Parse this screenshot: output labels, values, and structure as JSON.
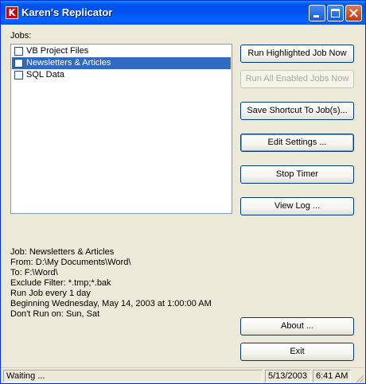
{
  "window": {
    "title": "Karen's Replicator",
    "icon_letter": "K"
  },
  "jobs": {
    "label": "Jobs:",
    "items": [
      {
        "label": "VB Project Files",
        "checked": false,
        "selected": false
      },
      {
        "label": "Newsletters & Articles",
        "checked": false,
        "selected": true
      },
      {
        "label": "SQL Data",
        "checked": false,
        "selected": false
      }
    ]
  },
  "buttons": {
    "run_highlighted": "Run Highlighted Job Now",
    "run_all_enabled": "Run All Enabled Jobs Now",
    "save_shortcut": "Save Shortcut To Job(s)...",
    "edit_settings": "Edit Settings ...",
    "stop_timer": "Stop Timer",
    "view_log": "View Log ...",
    "about": "About ...",
    "exit": "Exit"
  },
  "job_info": {
    "job": "Job: Newsletters & Articles",
    "from": "From: D:\\My Documents\\Word\\",
    "to": "To: F:\\Word\\",
    "exclude": "Exclude Filter: *.tmp;*.bak",
    "run": "Run Job every 1 day",
    "beginning": "Beginning Wednesday, May 14, 2003 at 1:00:00 AM",
    "dont_run": "Don't Run on: Sun, Sat"
  },
  "status": {
    "text": "Waiting ...",
    "date": "5/13/2003",
    "time": "6:41 AM"
  },
  "icons": [
    "minimize-icon",
    "maximize-icon",
    "close-icon",
    "size-grip-icon"
  ]
}
